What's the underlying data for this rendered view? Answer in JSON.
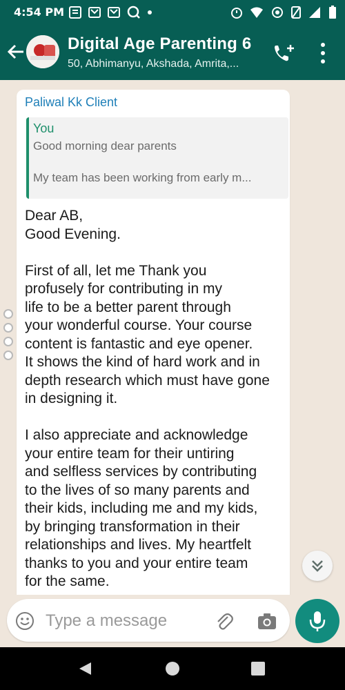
{
  "status_bar": {
    "time": "4:54 PM"
  },
  "header": {
    "title": "Digital Age Parenting 6",
    "subtitle": "50, Abhimanyu, Akshada, Amrita,..."
  },
  "message": {
    "sender": "Paliwal Kk Client",
    "quoted": {
      "author": "You",
      "line1": "Good morning dear parents",
      "line2": "My team has been working from early m..."
    },
    "body": "Dear AB,\nGood Evening.\n\nFirst of all, let me Thank you\nprofusely for contributing in my\nlife to be a better parent through\nyour wonderful course. Your course\ncontent is fantastic and eye opener.\nIt shows the kind of hard work and in\ndepth research which must have gone\nin designing it.\n\nI also appreciate and acknowledge\nyour entire team for their untiring\nand selfless services by contributing\nto the lives of so many parents and\ntheir kids, including me and my kids,\nby bringing transformation in their\nrelationships and lives. My heartfelt\nthanks to you and your entire team\nfor the same."
  },
  "composer": {
    "placeholder": "Type a message"
  },
  "colors": {
    "header": "#075e54",
    "accent": "#128c7e",
    "sender": "#1e7fb8",
    "quote_author": "#1e8f6b"
  }
}
